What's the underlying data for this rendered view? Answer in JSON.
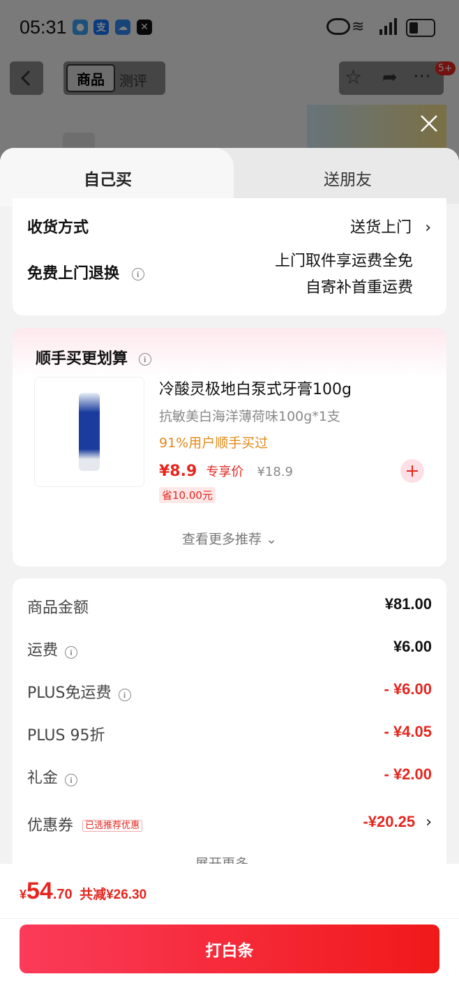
{
  "status": {
    "time": "05:31"
  },
  "background": {
    "tab_product": "商品",
    "tab_review": "测评",
    "cart_badge": "5+"
  },
  "sheet": {
    "tabs": {
      "buy_self": "自己买",
      "gift": "送朋友"
    },
    "delivery": {
      "method_label": "收货方式",
      "method_value": "送货上门",
      "return_label": "免费上门退换",
      "return_line1": "上门取件享运费全免",
      "return_line2": "自寄补首重运费"
    },
    "recommend": {
      "title": "顺手买更划算",
      "product_name": "冷酸灵极地白泵式牙膏100g",
      "product_spec": "抗敏美白海洋薄荷味100g*1支",
      "product_social": "91%用户顺手买过",
      "price": "¥8.9",
      "price_tag": "专享价",
      "original_price": "¥18.9",
      "save_badge": "省10.00元",
      "more": "查看更多推荐"
    },
    "summary": {
      "rows": [
        {
          "label": "商品金额",
          "value": "¥81.00",
          "info": false,
          "red": false
        },
        {
          "label": "运费",
          "value": "¥6.00",
          "info": true,
          "red": false
        },
        {
          "label": "PLUS免运费",
          "value": "- ¥6.00",
          "info": true,
          "red": true
        },
        {
          "label": "PLUS 95折",
          "value": "- ¥4.05",
          "info": false,
          "red": true
        },
        {
          "label": "礼金",
          "value": "- ¥2.00",
          "info": true,
          "red": true
        }
      ],
      "coupon_label": "优惠券",
      "coupon_badge": "已选推荐优惠",
      "coupon_value": "-¥20.25",
      "expand": "展开更多"
    },
    "footer": {
      "currency": "¥",
      "total_int": "54",
      "total_dec": ".70",
      "reduced": "共减¥26.30",
      "pay_button": "打白条"
    }
  },
  "colors": {
    "accent": "#e4261f",
    "pay_start": "#fb3b5a",
    "pay_end": "#f01919"
  }
}
